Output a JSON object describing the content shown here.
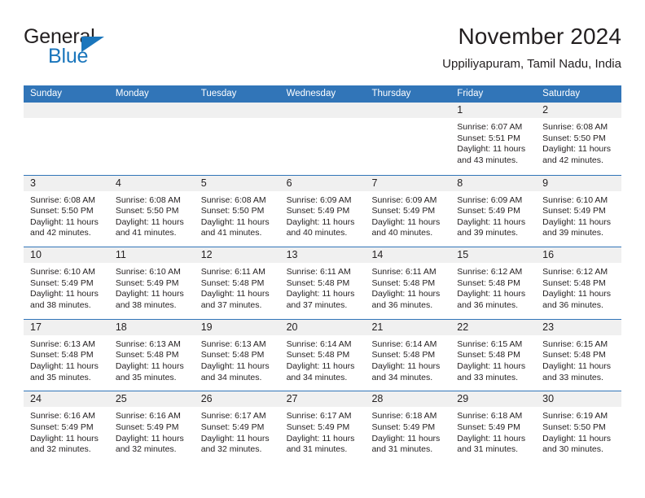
{
  "brand": {
    "name_part1": "General",
    "name_part2": "Blue",
    "triangle_color": "#1b76bc"
  },
  "header": {
    "title": "November 2024",
    "subtitle": "Uppiliyapuram, Tamil Nadu, India"
  },
  "theme": {
    "header_blue": "#3175b8",
    "daynum_band": "#f0f0f0",
    "text": "#231f20"
  },
  "calendar": {
    "weekdays": [
      "Sunday",
      "Monday",
      "Tuesday",
      "Wednesday",
      "Thursday",
      "Friday",
      "Saturday"
    ],
    "labels": {
      "sunrise_prefix": "Sunrise:",
      "sunset_prefix": "Sunset:",
      "daylight_prefix": "Daylight:"
    },
    "weeks": [
      [
        {
          "day": "",
          "empty": true
        },
        {
          "day": "",
          "empty": true
        },
        {
          "day": "",
          "empty": true
        },
        {
          "day": "",
          "empty": true
        },
        {
          "day": "",
          "empty": true
        },
        {
          "day": "1",
          "sunrise": "Sunrise: 6:07 AM",
          "sunset": "Sunset: 5:51 PM",
          "daylight_line1": "Daylight: 11 hours",
          "daylight_line2": "and 43 minutes."
        },
        {
          "day": "2",
          "sunrise": "Sunrise: 6:08 AM",
          "sunset": "Sunset: 5:50 PM",
          "daylight_line1": "Daylight: 11 hours",
          "daylight_line2": "and 42 minutes."
        }
      ],
      [
        {
          "day": "3",
          "sunrise": "Sunrise: 6:08 AM",
          "sunset": "Sunset: 5:50 PM",
          "daylight_line1": "Daylight: 11 hours",
          "daylight_line2": "and 42 minutes."
        },
        {
          "day": "4",
          "sunrise": "Sunrise: 6:08 AM",
          "sunset": "Sunset: 5:50 PM",
          "daylight_line1": "Daylight: 11 hours",
          "daylight_line2": "and 41 minutes."
        },
        {
          "day": "5",
          "sunrise": "Sunrise: 6:08 AM",
          "sunset": "Sunset: 5:50 PM",
          "daylight_line1": "Daylight: 11 hours",
          "daylight_line2": "and 41 minutes."
        },
        {
          "day": "6",
          "sunrise": "Sunrise: 6:09 AM",
          "sunset": "Sunset: 5:49 PM",
          "daylight_line1": "Daylight: 11 hours",
          "daylight_line2": "and 40 minutes."
        },
        {
          "day": "7",
          "sunrise": "Sunrise: 6:09 AM",
          "sunset": "Sunset: 5:49 PM",
          "daylight_line1": "Daylight: 11 hours",
          "daylight_line2": "and 40 minutes."
        },
        {
          "day": "8",
          "sunrise": "Sunrise: 6:09 AM",
          "sunset": "Sunset: 5:49 PM",
          "daylight_line1": "Daylight: 11 hours",
          "daylight_line2": "and 39 minutes."
        },
        {
          "day": "9",
          "sunrise": "Sunrise: 6:10 AM",
          "sunset": "Sunset: 5:49 PM",
          "daylight_line1": "Daylight: 11 hours",
          "daylight_line2": "and 39 minutes."
        }
      ],
      [
        {
          "day": "10",
          "sunrise": "Sunrise: 6:10 AM",
          "sunset": "Sunset: 5:49 PM",
          "daylight_line1": "Daylight: 11 hours",
          "daylight_line2": "and 38 minutes."
        },
        {
          "day": "11",
          "sunrise": "Sunrise: 6:10 AM",
          "sunset": "Sunset: 5:49 PM",
          "daylight_line1": "Daylight: 11 hours",
          "daylight_line2": "and 38 minutes."
        },
        {
          "day": "12",
          "sunrise": "Sunrise: 6:11 AM",
          "sunset": "Sunset: 5:48 PM",
          "daylight_line1": "Daylight: 11 hours",
          "daylight_line2": "and 37 minutes."
        },
        {
          "day": "13",
          "sunrise": "Sunrise: 6:11 AM",
          "sunset": "Sunset: 5:48 PM",
          "daylight_line1": "Daylight: 11 hours",
          "daylight_line2": "and 37 minutes."
        },
        {
          "day": "14",
          "sunrise": "Sunrise: 6:11 AM",
          "sunset": "Sunset: 5:48 PM",
          "daylight_line1": "Daylight: 11 hours",
          "daylight_line2": "and 36 minutes."
        },
        {
          "day": "15",
          "sunrise": "Sunrise: 6:12 AM",
          "sunset": "Sunset: 5:48 PM",
          "daylight_line1": "Daylight: 11 hours",
          "daylight_line2": "and 36 minutes."
        },
        {
          "day": "16",
          "sunrise": "Sunrise: 6:12 AM",
          "sunset": "Sunset: 5:48 PM",
          "daylight_line1": "Daylight: 11 hours",
          "daylight_line2": "and 36 minutes."
        }
      ],
      [
        {
          "day": "17",
          "sunrise": "Sunrise: 6:13 AM",
          "sunset": "Sunset: 5:48 PM",
          "daylight_line1": "Daylight: 11 hours",
          "daylight_line2": "and 35 minutes."
        },
        {
          "day": "18",
          "sunrise": "Sunrise: 6:13 AM",
          "sunset": "Sunset: 5:48 PM",
          "daylight_line1": "Daylight: 11 hours",
          "daylight_line2": "and 35 minutes."
        },
        {
          "day": "19",
          "sunrise": "Sunrise: 6:13 AM",
          "sunset": "Sunset: 5:48 PM",
          "daylight_line1": "Daylight: 11 hours",
          "daylight_line2": "and 34 minutes."
        },
        {
          "day": "20",
          "sunrise": "Sunrise: 6:14 AM",
          "sunset": "Sunset: 5:48 PM",
          "daylight_line1": "Daylight: 11 hours",
          "daylight_line2": "and 34 minutes."
        },
        {
          "day": "21",
          "sunrise": "Sunrise: 6:14 AM",
          "sunset": "Sunset: 5:48 PM",
          "daylight_line1": "Daylight: 11 hours",
          "daylight_line2": "and 34 minutes."
        },
        {
          "day": "22",
          "sunrise": "Sunrise: 6:15 AM",
          "sunset": "Sunset: 5:48 PM",
          "daylight_line1": "Daylight: 11 hours",
          "daylight_line2": "and 33 minutes."
        },
        {
          "day": "23",
          "sunrise": "Sunrise: 6:15 AM",
          "sunset": "Sunset: 5:48 PM",
          "daylight_line1": "Daylight: 11 hours",
          "daylight_line2": "and 33 minutes."
        }
      ],
      [
        {
          "day": "24",
          "sunrise": "Sunrise: 6:16 AM",
          "sunset": "Sunset: 5:49 PM",
          "daylight_line1": "Daylight: 11 hours",
          "daylight_line2": "and 32 minutes."
        },
        {
          "day": "25",
          "sunrise": "Sunrise: 6:16 AM",
          "sunset": "Sunset: 5:49 PM",
          "daylight_line1": "Daylight: 11 hours",
          "daylight_line2": "and 32 minutes."
        },
        {
          "day": "26",
          "sunrise": "Sunrise: 6:17 AM",
          "sunset": "Sunset: 5:49 PM",
          "daylight_line1": "Daylight: 11 hours",
          "daylight_line2": "and 32 minutes."
        },
        {
          "day": "27",
          "sunrise": "Sunrise: 6:17 AM",
          "sunset": "Sunset: 5:49 PM",
          "daylight_line1": "Daylight: 11 hours",
          "daylight_line2": "and 31 minutes."
        },
        {
          "day": "28",
          "sunrise": "Sunrise: 6:18 AM",
          "sunset": "Sunset: 5:49 PM",
          "daylight_line1": "Daylight: 11 hours",
          "daylight_line2": "and 31 minutes."
        },
        {
          "day": "29",
          "sunrise": "Sunrise: 6:18 AM",
          "sunset": "Sunset: 5:49 PM",
          "daylight_line1": "Daylight: 11 hours",
          "daylight_line2": "and 31 minutes."
        },
        {
          "day": "30",
          "sunrise": "Sunrise: 6:19 AM",
          "sunset": "Sunset: 5:50 PM",
          "daylight_line1": "Daylight: 11 hours",
          "daylight_line2": "and 30 minutes."
        }
      ]
    ]
  }
}
